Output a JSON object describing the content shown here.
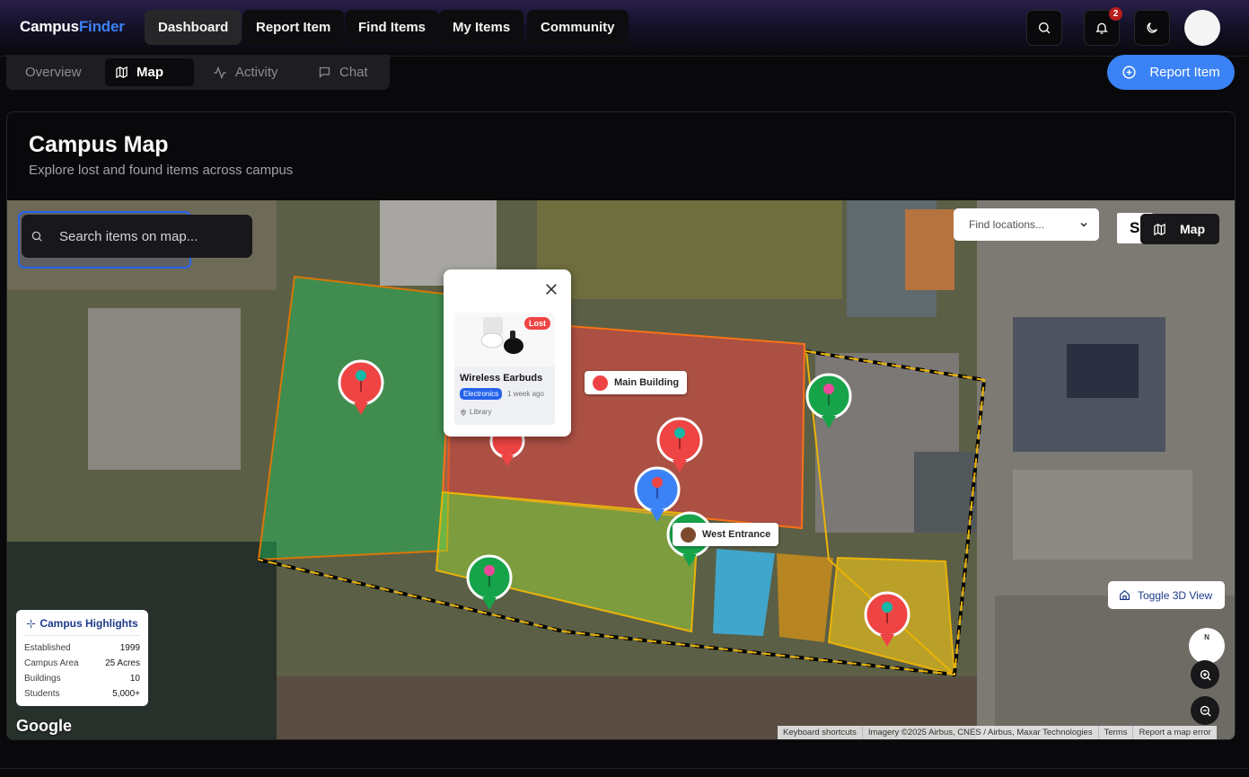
{
  "app": {
    "name_part1": "Campus",
    "name_part2": "Finder"
  },
  "nav": {
    "items": [
      {
        "label": "Dashboard",
        "active": true
      },
      {
        "label": "Report Item",
        "active": false
      },
      {
        "label": "Find Items",
        "active": false
      },
      {
        "label": "My Items",
        "active": false
      },
      {
        "label": "Community",
        "active": false
      }
    ],
    "notification_count": "2"
  },
  "subtabs": [
    {
      "label": "Overview",
      "icon": "none",
      "active": false
    },
    {
      "label": "Map",
      "icon": "map-icon",
      "active": true
    },
    {
      "label": "Activity",
      "icon": "activity-icon",
      "active": false
    },
    {
      "label": "Chat",
      "icon": "chat-icon",
      "active": false
    }
  ],
  "report_button": "Report Item",
  "card": {
    "title": "Campus Map",
    "subtitle": "Explore lost and found items across campus"
  },
  "map": {
    "search_placeholder": "Search items on map...",
    "find_locations_placeholder": "Find locations...",
    "satellite_partial": "S",
    "map_toggle_label": "Map",
    "toggle_3d_label": "Toggle 3D View",
    "compass_label": "N",
    "google_label": "Google",
    "attribution": [
      "Keyboard shortcuts",
      "Imagery ©2025 Airbus, CNES / Airbus, Maxar Technologies",
      "Terms",
      "Report a map error"
    ],
    "locations": [
      {
        "label": "Main Building",
        "color": "#ef4444"
      },
      {
        "label": "West Entrance",
        "color": "#7c4a2d"
      }
    ],
    "popup": {
      "status": "Lost",
      "title": "Wireless Earbuds",
      "category": "Electronics",
      "time": "1 week ago",
      "location": "Library"
    },
    "highlights": {
      "title": "Campus Highlights",
      "rows": [
        {
          "label": "Established",
          "value": "1999"
        },
        {
          "label": "Campus Area",
          "value": "25 Acres"
        },
        {
          "label": "Buildings",
          "value": "10"
        },
        {
          "label": "Students",
          "value": "5,000+"
        }
      ]
    },
    "colors": {
      "lost": "#ef4444",
      "found": "#16a34a",
      "selected": "#3b82f6"
    }
  }
}
